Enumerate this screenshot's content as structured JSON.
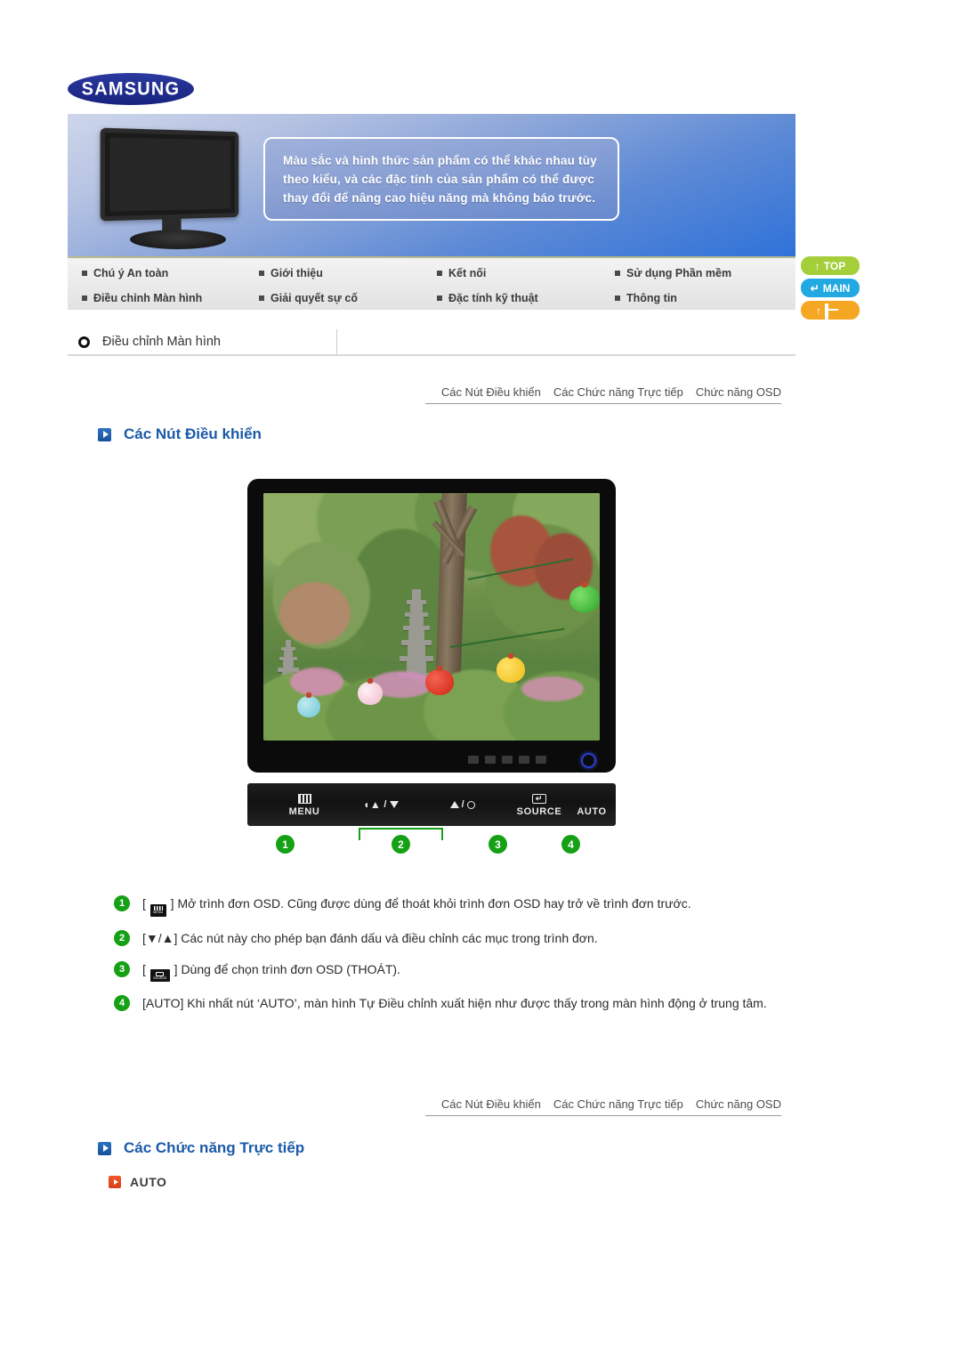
{
  "brand": {
    "logo_text": "SAMSUNG"
  },
  "banner": {
    "notice_line1": "Màu sắc và hình thức sản phẩm có thể khác nhau tùy",
    "notice_line2": "theo kiểu, và các đặc tính của sản phẩm có thể được",
    "notice_line3": "thay đổi để nâng cao hiệu năng mà không báo trước."
  },
  "nav": {
    "items": [
      "Chú ý An toàn",
      "Giới thiệu",
      "Kết nối",
      "Sử dụng Phần mềm",
      "Điều chỉnh Màn hình",
      "Giải quyết sự cố",
      "Đặc tính kỹ thuật",
      "Thông tin"
    ]
  },
  "side_buttons": {
    "top": "TOP",
    "main": "MAIN",
    "home": ""
  },
  "page_title": "Điều chỉnh Màn hình",
  "tabs": {
    "items": [
      "Các Nút Điều khiển",
      "Các Chức năng Trực tiếp",
      "Chức năng OSD"
    ]
  },
  "sections": {
    "controls_heading": "Các Nút Điều khiển",
    "direct_heading": "Các Chức năng Trực tiếp"
  },
  "control_panel": {
    "buttons": [
      {
        "label": "MENU",
        "icon": "menu-grid-icon"
      },
      {
        "label": "",
        "icon": "volume-down-icon"
      },
      {
        "label": "",
        "icon": "brightness-up-icon"
      },
      {
        "label": "SOURCE",
        "icon": "enter-box-icon"
      },
      {
        "label": "AUTO",
        "icon": "none"
      }
    ],
    "badges": [
      "1",
      "2",
      "3",
      "4"
    ]
  },
  "descriptions": [
    {
      "num": "1",
      "pre": "[",
      "icon": "menu-button-icon",
      "text": "] Mở trình đơn OSD. Cũng được dùng để thoát khỏi trình đơn OSD hay trở về trình đơn trước."
    },
    {
      "num": "2",
      "pre": "",
      "icon": "none",
      "text": "[▼/▲] Các nút này cho phép bạn đánh dấu và điều chỉnh các mục trong trình đơn."
    },
    {
      "num": "3",
      "pre": "[",
      "icon": "source-button-icon",
      "text": "] Dùng để chọn trình đơn OSD (THOÁT)."
    },
    {
      "num": "4",
      "pre": "",
      "icon": "none",
      "text": "[AUTO] Khi nhất nút ‘AUTO’, màn hình Tự Điều chỉnh xuất hiện như được thấy trong màn hình động ở trung tâm."
    }
  ],
  "direct_functions": {
    "auto_label": "AUTO"
  },
  "colors": {
    "brand_blue": "#1f2f8f",
    "heading_blue": "#1a5aa8",
    "badge_green": "#15a015",
    "accent_orange": "#f0562a",
    "pill_top": "#a4cf3b",
    "pill_main": "#23a9e1",
    "pill_home": "#f5a623"
  }
}
